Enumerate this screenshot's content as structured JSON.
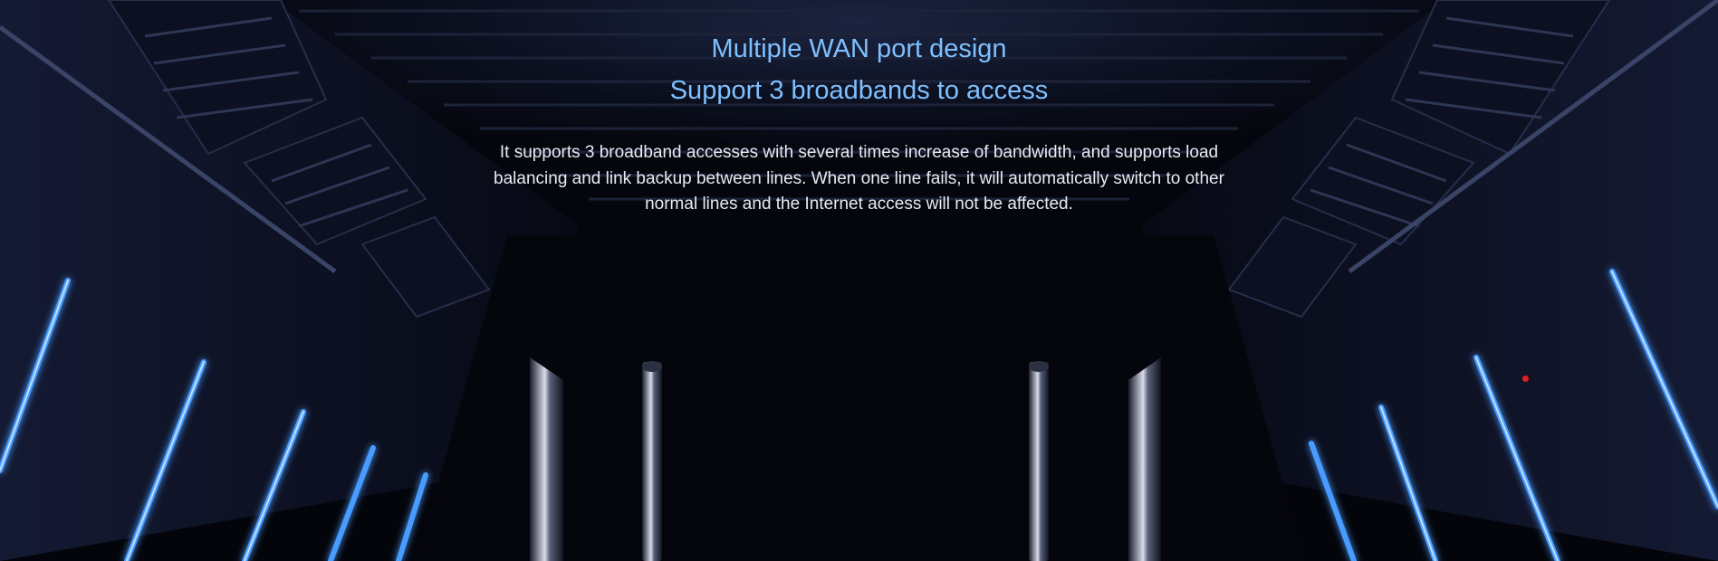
{
  "hero": {
    "title_line_1": "Multiple WAN port design",
    "title_line_2": "Support 3 broadbands to access",
    "description": "It supports 3 broadband accesses with several times increase of bandwidth, and supports load balancing and link backup between lines. When one line fails, it will automatically switch to other normal lines and the Internet access will not be affected."
  },
  "colors": {
    "background": "#05060d",
    "title": "#7fc0ff",
    "body_text": "#e8ebf2",
    "neon": "#3f8dff",
    "marker": "#e02020"
  }
}
